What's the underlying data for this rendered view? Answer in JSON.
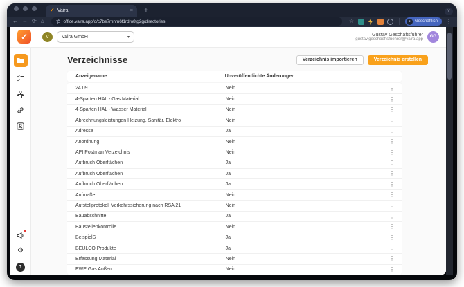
{
  "browser": {
    "tab_title": "Vaira",
    "tab_close": "×",
    "new_tab": "+",
    "tab_search_chevron": "˅",
    "nav": {
      "back": "←",
      "forward": "→",
      "reload": "⟳",
      "home": "⌂"
    },
    "url": "office.vaira.app/o/c7be7mnm6f1rdro8tg2g/directories",
    "bookmark_star": "☆",
    "profile_label": "Geschäftlich",
    "menu_icon_glyph": "⋮",
    "extension_icons": [
      "teal-extension-icon",
      "bolt-extension-icon",
      "orange-extension-icon",
      "outline-extension-icon"
    ]
  },
  "app_header": {
    "logo_glyph": "✓",
    "org_initial": "V",
    "org_name": "Vaira GmbH",
    "select_chevron": "▾",
    "user_name": "Gustav Geschäftsführer",
    "user_email": "gustav.geschaeftsfuehrer@vaira.app",
    "user_initials": "GG"
  },
  "sidebar": {
    "items": [
      "directories-icon (active)",
      "forms-icon",
      "workflow-icon",
      "links-icon",
      "contacts-icon"
    ],
    "bottom_items": [
      "announcements-icon (red badge)",
      "settings-gear-icon",
      "help-button"
    ],
    "gear_glyph": "⚙",
    "help_glyph": "?"
  },
  "page": {
    "title": "Verzeichnisse",
    "import_button": "Verzeichnis importieren",
    "create_button": "Verzeichnis erstellen"
  },
  "table": {
    "columns": [
      "Anzeigename",
      "Unveröffentlichte Änderungen"
    ],
    "menu_icon": "⋮",
    "rows": [
      {
        "name": "24.09.",
        "changes": "Nein"
      },
      {
        "name": "4-Sparten HAL - Gas Material",
        "changes": "Nein"
      },
      {
        "name": "4-Sparten HAL - Wasser Material",
        "changes": "Nein"
      },
      {
        "name": "Abrechnungsleistungen Heizung, Sanitär, Elektro",
        "changes": "Nein"
      },
      {
        "name": "Adresse",
        "changes": "Ja"
      },
      {
        "name": "Anordnung",
        "changes": "Nein"
      },
      {
        "name": "API Postman Verzeichnis",
        "changes": "Nein"
      },
      {
        "name": "Aufbruch Oberflächen",
        "changes": "Ja"
      },
      {
        "name": "Aufbruch Oberflächen",
        "changes": "Ja"
      },
      {
        "name": "Aufbruch Oberflächen",
        "changes": "Ja"
      },
      {
        "name": "Aufmaße",
        "changes": "Nein"
      },
      {
        "name": "Aufstellprotokoll Verkehrssicherung nach RSA 21",
        "changes": "Nein"
      },
      {
        "name": "Bauabschnitte",
        "changes": "Ja"
      },
      {
        "name": "Baustellenkontrolle",
        "changes": "Nein"
      },
      {
        "name": "BeispielS",
        "changes": "Ja"
      },
      {
        "name": "BEULCO Produkte",
        "changes": "Ja"
      },
      {
        "name": "Erfassung Material",
        "changes": "Nein"
      },
      {
        "name": "EWE Gas Außen",
        "changes": "Nein"
      }
    ]
  },
  "colors": {
    "accent_orange": "#f9a11b",
    "logo_gradient_start": "#ff9d2e",
    "logo_gradient_end": "#f0512a",
    "chrome_dark": "#1c2230",
    "profile_pill_blue": "#4565be",
    "badge_red": "#e53935"
  }
}
